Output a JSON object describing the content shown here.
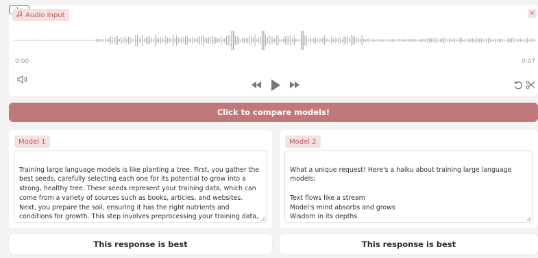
{
  "audio": {
    "label": "Audio Input",
    "label_icon": "music-note-icon",
    "close_label": "×",
    "time_start": "0:00",
    "time_end": "0:07",
    "speed": "1x",
    "icons": [
      "volume-icon",
      "rewind-icon",
      "play-icon",
      "fast-forward-icon",
      "undo-icon",
      "scissors-icon"
    ]
  },
  "compare_button": "Click to compare models!",
  "models": [
    {
      "label": "Model 1",
      "response": "Training large language models is like planting a tree. First, you gather the best seeds, carefully selecting each one for its potential to grow into a strong, healthy tree. These seeds represent your training data, which can come from a variety of sources such as books, articles, and websites. Next, you prepare the soil, ensuring it has the right nutrients and conditions for growth. This step involves preprocessing your training data, cleaning it, and formatting it in a way that the model can",
      "best_label": "This response is best"
    },
    {
      "label": "Model 2",
      "response": "What a unique request! Here's a haiku about training large language models:\n\nText flows like a stream\nModel's mind absorbs and grows\nWisdom in its depths",
      "best_label": "This response is best"
    }
  ],
  "colors": {
    "accent": "#c07878",
    "chip_bg": "#f6e1e1",
    "chip_text": "#b85a5a"
  }
}
